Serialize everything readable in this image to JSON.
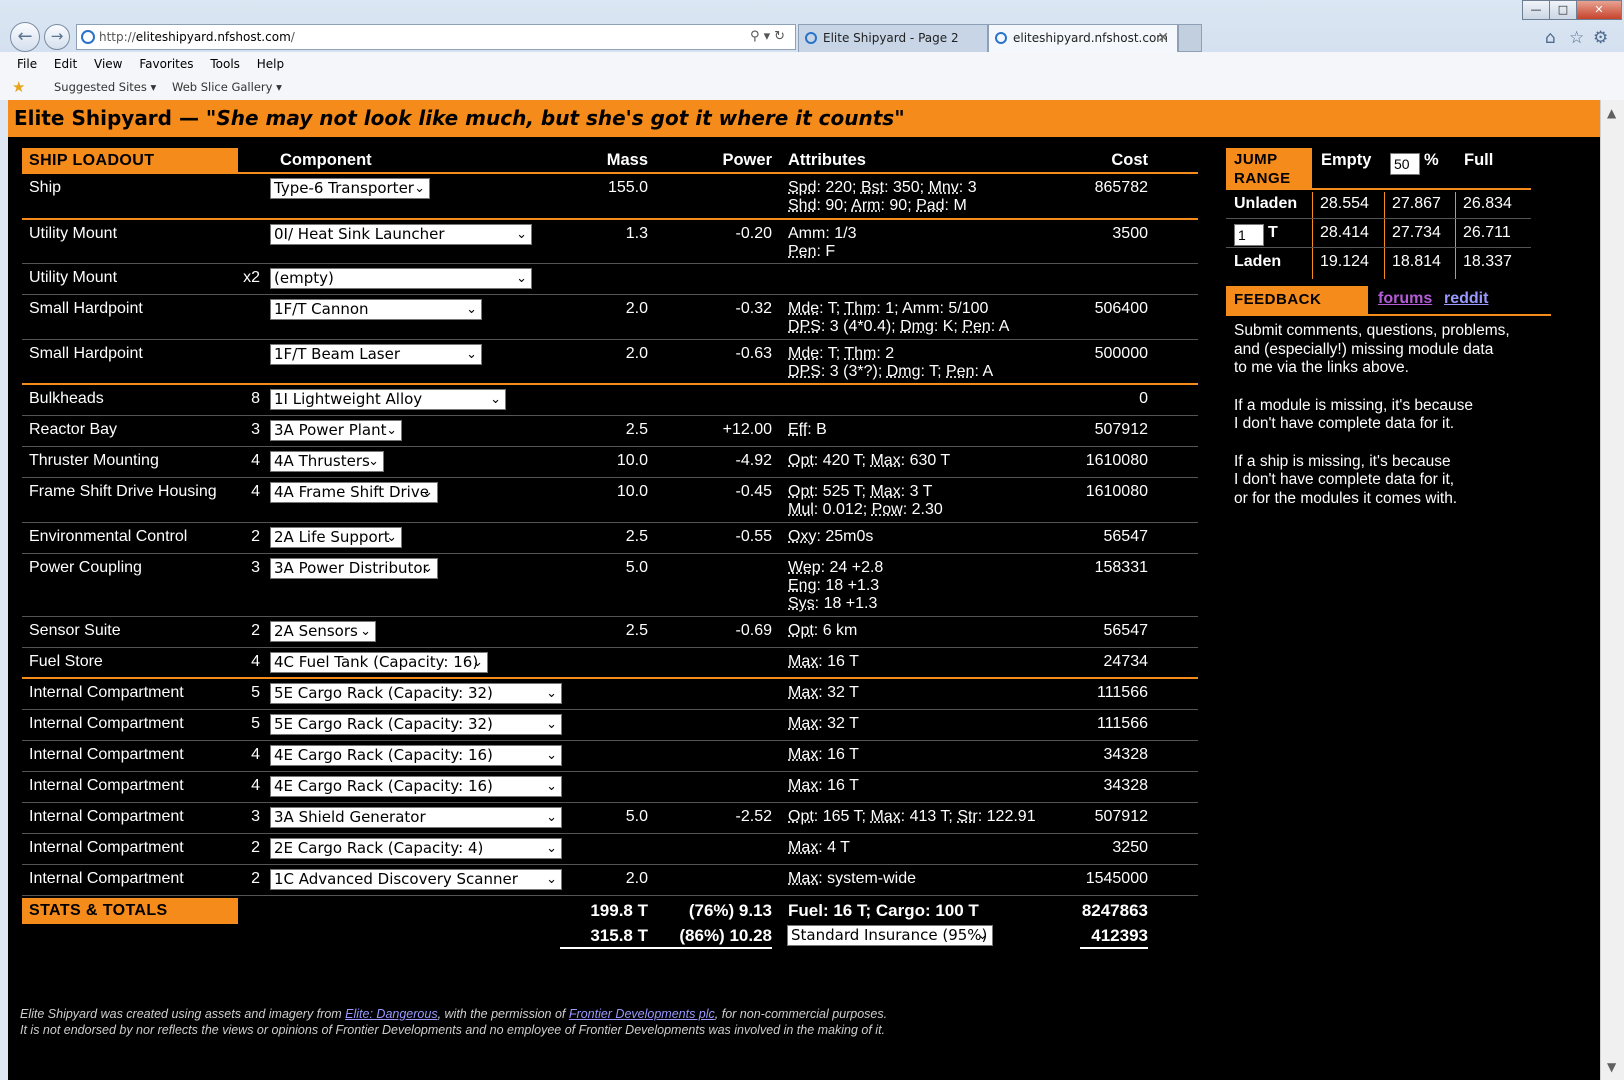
{
  "browser": {
    "url_prefix": "http://",
    "url_host": "eliteshipyard.nfshost.com",
    "url_suffix": "/",
    "tabs": [
      {
        "label": "Elite Shipyard - Page 2"
      },
      {
        "label": "eliteshipyard.nfshost.com"
      }
    ],
    "menu": [
      "File",
      "Edit",
      "View",
      "Favorites",
      "Tools",
      "Help"
    ],
    "favorites": [
      "Suggested Sites ▾",
      "Web Slice Gallery ▾"
    ]
  },
  "page": {
    "title": "Elite Shipyard —",
    "tagline": "\"She may not look like much, but she's got it where it counts\""
  },
  "loadout": {
    "header": {
      "section": "SHIP LOADOUT",
      "component": "Component",
      "mass": "Mass",
      "power": "Power",
      "attributes": "Attributes",
      "cost": "Cost"
    },
    "rows": [
      {
        "name": "Ship",
        "qty": "",
        "component": "Type-6 Transporter",
        "mass": "155.0",
        "power": "",
        "attrs": [
          "Spd: 220; Bst: 350; Mnv: 3",
          "Shd: 90; Arm: 90; Pad: M"
        ],
        "cost": "865782"
      },
      {
        "name": "Utility Mount",
        "qty": "",
        "component": "0I/ Heat Sink Launcher",
        "mass": "1.3",
        "power": "-0.20",
        "attrs": [
          "Amm: 1/3",
          "Pen: F"
        ],
        "cost": "3500"
      },
      {
        "name": "Utility Mount",
        "qty": "x2",
        "component": "(empty)",
        "mass": "",
        "power": "",
        "attrs": [],
        "cost": ""
      },
      {
        "name": "Small Hardpoint",
        "qty": "",
        "component": "1F/T Cannon",
        "mass": "2.0",
        "power": "-0.32",
        "attrs": [
          "Mde: T; Thm: 1; Amm: 5/100",
          "DPS: 3 (4*0.4); Dmg: K; Pen: A"
        ],
        "cost": "506400"
      },
      {
        "name": "Small Hardpoint",
        "qty": "",
        "component": "1F/T Beam Laser",
        "mass": "2.0",
        "power": "-0.63",
        "attrs": [
          "Mde: T; Thm: 2",
          "DPS: 3 (3*?); Dmg: T; Pen: A"
        ],
        "cost": "500000"
      },
      {
        "name": "Bulkheads",
        "qty": "8",
        "component": "1I Lightweight Alloy",
        "mass": "",
        "power": "",
        "attrs": [],
        "cost": "0"
      },
      {
        "name": "Reactor Bay",
        "qty": "3",
        "component": "3A Power Plant",
        "mass": "2.5",
        "power": "+12.00",
        "attrs": [
          "Eff: B"
        ],
        "cost": "507912"
      },
      {
        "name": "Thruster Mounting",
        "qty": "4",
        "component": "4A Thrusters",
        "mass": "10.0",
        "power": "-4.92",
        "attrs": [
          "Opt: 420 T; Max: 630 T"
        ],
        "cost": "1610080"
      },
      {
        "name": "Frame Shift Drive Housing",
        "qty": "4",
        "component": "4A Frame Shift Drive",
        "mass": "10.0",
        "power": "-0.45",
        "attrs": [
          "Opt: 525 T; Max: 3 T",
          "Mul: 0.012; Pow: 2.30"
        ],
        "cost": "1610080"
      },
      {
        "name": "Environmental Control",
        "qty": "2",
        "component": "2A Life Support",
        "mass": "2.5",
        "power": "-0.55",
        "attrs": [
          "Oxy: 25m0s"
        ],
        "cost": "56547"
      },
      {
        "name": "Power Coupling",
        "qty": "3",
        "component": "3A Power Distributor",
        "mass": "5.0",
        "power": "",
        "attrs": [
          "Wep: 24 +2.8",
          "Eng: 18 +1.3",
          "Sys: 18 +1.3"
        ],
        "cost": "158331"
      },
      {
        "name": "Sensor Suite",
        "qty": "2",
        "component": "2A Sensors",
        "mass": "2.5",
        "power": "-0.69",
        "attrs": [
          "Opt: 6 km"
        ],
        "cost": "56547"
      },
      {
        "name": "Fuel Store",
        "qty": "4",
        "component": "4C Fuel Tank (Capacity: 16)",
        "mass": "",
        "power": "",
        "attrs": [
          "Max: 16 T"
        ],
        "cost": "24734"
      },
      {
        "name": "Internal Compartment",
        "qty": "5",
        "component": "5E Cargo Rack (Capacity: 32)",
        "mass": "",
        "power": "",
        "attrs": [
          "Max: 32 T"
        ],
        "cost": "111566"
      },
      {
        "name": "Internal Compartment",
        "qty": "5",
        "component": "5E Cargo Rack (Capacity: 32)",
        "mass": "",
        "power": "",
        "attrs": [
          "Max: 32 T"
        ],
        "cost": "111566"
      },
      {
        "name": "Internal Compartment",
        "qty": "4",
        "component": "4E Cargo Rack (Capacity: 16)",
        "mass": "",
        "power": "",
        "attrs": [
          "Max: 16 T"
        ],
        "cost": "34328"
      },
      {
        "name": "Internal Compartment",
        "qty": "4",
        "component": "4E Cargo Rack (Capacity: 16)",
        "mass": "",
        "power": "",
        "attrs": [
          "Max: 16 T"
        ],
        "cost": "34328"
      },
      {
        "name": "Internal Compartment",
        "qty": "3",
        "component": "3A Shield Generator",
        "mass": "5.0",
        "power": "-2.52",
        "attrs": [
          "Opt: 165 T; Max: 413 T; Str: 122.91"
        ],
        "cost": "507912"
      },
      {
        "name": "Internal Compartment",
        "qty": "2",
        "component": "2E Cargo Rack (Capacity: 4)",
        "mass": "",
        "power": "",
        "attrs": [
          "Max: 4 T"
        ],
        "cost": "3250"
      },
      {
        "name": "Internal Compartment",
        "qty": "2",
        "component": "1C Advanced Discovery Scanner",
        "mass": "2.0",
        "power": "",
        "attrs": [
          "Max: system-wide"
        ],
        "cost": "1545000"
      }
    ],
    "totals": {
      "label": "STATS & TOTALS",
      "mass1": "199.8 T",
      "power1": "(76%) 9.13",
      "info1": "Fuel: 16 T; Cargo: 100 T",
      "cost1": "8247863",
      "mass2": "315.8 T",
      "power2": "(86%) 10.28",
      "insurance": "Standard Insurance (95%)",
      "cost2": "412393"
    }
  },
  "jump": {
    "label_line1": "JUMP",
    "label_line2": "RANGE",
    "empty": "Empty",
    "pct_value": "50",
    "pct_sign": "%",
    "full": "Full",
    "rows": [
      {
        "label": "Unladen",
        "v1": "28.554",
        "v2": "27.867",
        "v3": "26.834"
      },
      {
        "label": "T",
        "input": "1",
        "v1": "28.414",
        "v2": "27.734",
        "v3": "26.711"
      },
      {
        "label": "Laden",
        "v1": "19.124",
        "v2": "18.814",
        "v3": "18.337"
      }
    ]
  },
  "feedback": {
    "label": "FEEDBACK",
    "forums": "forums",
    "reddit": "reddit",
    "p1": [
      "Submit comments, questions, problems,",
      "and (especially!) missing module data",
      "to me via the links above."
    ],
    "p2": [
      "If a module is missing, it's because",
      "I don't have complete data for it."
    ],
    "p3": [
      "If a ship is missing, it's because",
      "I don't have complete data for it,",
      "or for the modules it comes with."
    ]
  },
  "footer": {
    "l1a": "Elite Shipyard was created using assets and imagery from ",
    "l1link1": "Elite: Dangerous",
    "l1b": ", with the permission of ",
    "l1link2": "Frontier Developments plc",
    "l1c": ", for non-commercial purposes.",
    "l2": "It is not endorsed by nor reflects the views or opinions of Frontier Developments and no employee of Frontier Developments was involved in the making of it."
  },
  "colors": {
    "accent": "#f58b1b",
    "background": "#000000",
    "link": "#9999ff"
  }
}
